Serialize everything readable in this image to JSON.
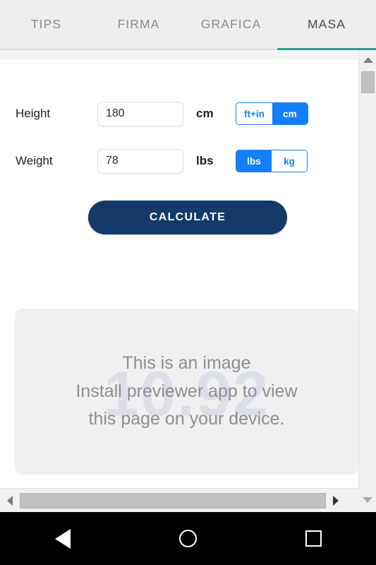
{
  "tabs": [
    {
      "label": "TIPS",
      "active": false
    },
    {
      "label": "FIRMA",
      "active": false
    },
    {
      "label": "GRAFICA",
      "active": false
    },
    {
      "label": "MASA",
      "active": true
    }
  ],
  "form": {
    "height_row": {
      "label": "Height",
      "value": "180",
      "placeholder": "",
      "unit": "cm",
      "toggle": [
        {
          "label": "ft+in",
          "selected": false
        },
        {
          "label": "cm",
          "selected": true
        }
      ]
    },
    "weight_row": {
      "label": "Weight",
      "value": "78",
      "placeholder": "",
      "unit": "lbs",
      "toggle": [
        {
          "label": "lbs",
          "selected": true
        },
        {
          "label": "kg",
          "selected": false
        }
      ]
    },
    "calculate_label": "CALCULATE"
  },
  "image_placeholder": {
    "line1": "This is an image",
    "line2": "Install previewer app to view",
    "line3": "this page on your device.",
    "watermark": "10.92"
  },
  "icons": {
    "scroll_up": "triangle-up-icon",
    "scroll_down": "triangle-down-icon",
    "scroll_left": "triangle-left-icon",
    "scroll_right": "triangle-right-icon",
    "nav_back": "back-triangle-icon",
    "nav_home": "home-circle-icon",
    "nav_recent": "recents-square-icon"
  },
  "colors": {
    "active_tab_underline": "#26a187",
    "toggle_selected": "#157efb",
    "toggle_border": "#1b7fe8",
    "calculate_bg": "#143a69",
    "tabbar_bg": "#eeeeee",
    "placeholder_bg": "#f0f0f0",
    "watermark": "#ccd2e0",
    "navbar_bg": "#000000"
  }
}
